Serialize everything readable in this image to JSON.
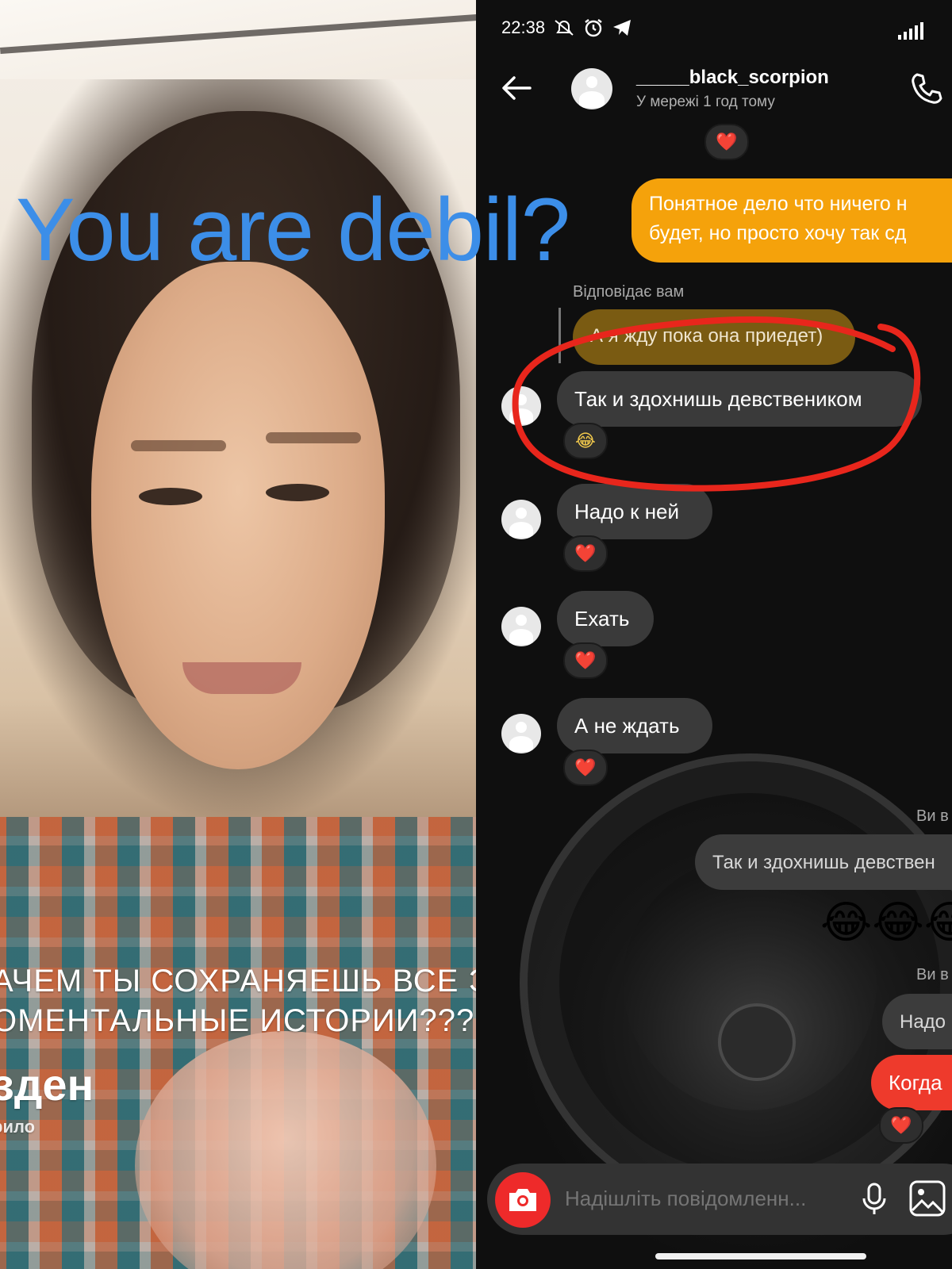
{
  "photo": {
    "caption_line1": "АЧЕМ ТЫ СОХРАНЯЕШЬ ВСЕ Э",
    "caption_line2": "ОМЕНТАЛЬНЫЕ ИСТОРИИ???",
    "caption_name": "зден",
    "caption_sub": "рило"
  },
  "overlay_text": "You are debil?",
  "status_bar": {
    "time": "22:38",
    "icons": [
      "mute-icon",
      "alarm-icon",
      "telegram-icon",
      "signal-icon"
    ]
  },
  "header": {
    "username": "_____black_scorpion",
    "status": "У мережі 1 год тому"
  },
  "messages": {
    "top_reaction": "❤️",
    "sent_1_line1": "Понятное дело что ничего н",
    "sent_1_line2": "будет, но просто хочу так сд",
    "reply_label": "Відповідає вам",
    "reply_quote": "А я жду пока она приедет)",
    "m1": "Так и здохнишь девствеником",
    "m1_reaction": "😂",
    "m2": "Надо к ней",
    "m2_reaction": "❤️",
    "m3": "Ехать",
    "m3_reaction": "❤️",
    "m4": "А не ждать",
    "m4_reaction": "❤️",
    "you_label_1": "Ви в",
    "quote_2": "Так и здохнишь девствен",
    "emojis": "😂😂😂",
    "you_label_2": "Ви в",
    "quote_3": "Надо",
    "sent_2": "Когда",
    "sent_2_reaction": "❤️"
  },
  "composer": {
    "placeholder": "Надішліть повідомленн..."
  },
  "colors": {
    "overlay_blue": "#3c8ee8",
    "sent_orange": "#f5a20b",
    "sent_red": "#ee3a2c",
    "annotation_red": "#e8261c",
    "camera_red": "#ee2a2a"
  }
}
